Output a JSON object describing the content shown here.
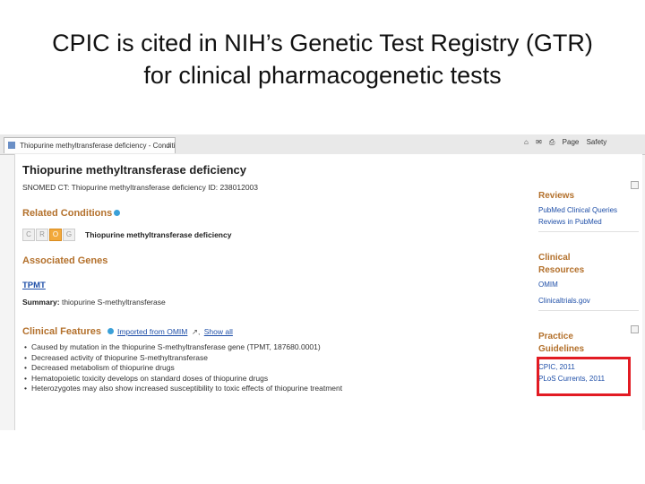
{
  "slide": {
    "title_line1": "CPIC is cited in NIH’s Genetic Test Registry (GTR)",
    "title_line2": "for clinical pharmacogenetic tests"
  },
  "browser": {
    "tab_title": "Thiopurine methyltransferase deficiency - Conditions -",
    "tab_close": "×",
    "tools": [
      "Page",
      "Safety"
    ],
    "tool_glyphs": [
      "⌂",
      "✉",
      "⎙"
    ]
  },
  "main": {
    "heading": "Thiopurine methyltransferase deficiency",
    "snomed": "SNOMED CT: Thiopurine methyltransferase deficiency  ID: 238012003",
    "related_conditions": {
      "label": "Related Conditions",
      "letters": [
        "C",
        "R",
        "O",
        "G"
      ],
      "condition": "Thiopurine methyltransferase deficiency"
    },
    "associated_genes": {
      "label": "Associated Genes",
      "gene": "TPMT",
      "summary_label": "Summary:",
      "summary": "thiopurine S-methyltransferase"
    },
    "clinical_features": {
      "label": "Clinical Features",
      "imported_link": "Imported from OMIM",
      "comma": ",",
      "show_all": "Show all",
      "items": [
        "Caused by mutation in the thiopurine S-methyltransferase gene (TPMT, 187680.0001)",
        "Decreased activity of thiopurine S-methyltransferase",
        "Decreased metabolism of thiopurine drugs",
        "Hematopoietic toxicity develops on standard doses of thiopurine drugs",
        "Heterozygotes may also show increased susceptibility to toxic effects of thiopurine treatment"
      ]
    }
  },
  "sidebar": {
    "reviews": {
      "label": "Reviews",
      "links": [
        "PubMed Clinical Queries",
        "Reviews in PubMed"
      ]
    },
    "clinical_resources": {
      "label_line1": "Clinical",
      "label_line2": "Resources",
      "links": [
        "OMIM",
        "Clinicaltrials.gov"
      ]
    },
    "practice_guidelines": {
      "label_line1": "Practice",
      "label_line2": "Guidelines",
      "links": [
        "CPIC, 2011",
        "PLoS Currents, 2011"
      ]
    }
  },
  "colors": {
    "section_heading": "#b3702b",
    "link": "#1f4fa8",
    "highlight_box": "#e21b23"
  }
}
